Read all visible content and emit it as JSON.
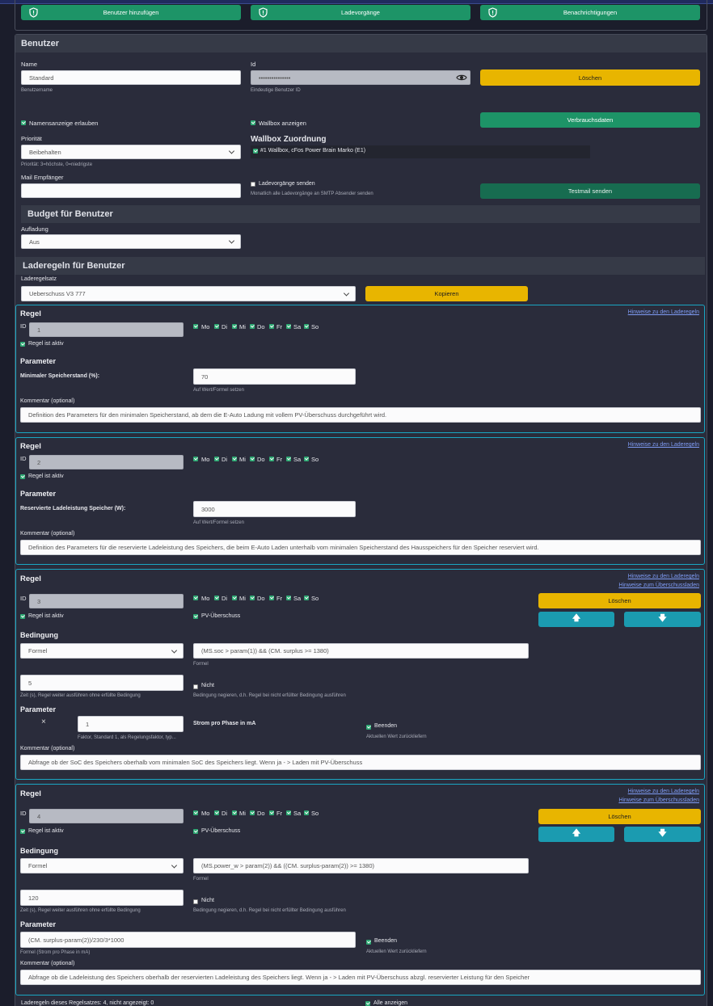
{
  "toolbar": {
    "add_user": "Benutzer hinzufügen",
    "charges": "Ladevorgänge",
    "notifications": "Benachrichtigungen"
  },
  "user": {
    "section_title": "Benutzer",
    "name_label": "Name",
    "name_value": "Standard",
    "name_hint": "Benutzername",
    "id_label": "Id",
    "id_value": "•••••••••••••••",
    "id_hint": "Eindeutige Benutzer ID",
    "delete": "Löschen",
    "show_name": "Namensanzeige erlauben",
    "show_wallbox": "Wallbox anzeigen",
    "consumption": "Verbrauchsdaten",
    "priority_label": "Priorität",
    "priority_value": "Beibehalten",
    "priority_hint": "Priorität: 3=höchste, 0=niedrigste",
    "wallbox_title": "Wallbox Zuordnung",
    "wallbox_item": "#1 Wallbox, cFos Power Brain Marko (E1)",
    "mail_label": "Mail Empfänger",
    "mail_value": "",
    "send_charges": "Ladevorgänge senden",
    "send_charges_hint": "Monatlich alle Ladevorgänge an SMTP Absender senden",
    "testmail": "Testmail senden"
  },
  "budget": {
    "title": "Budget für Benutzer",
    "charge_label": "Aufladung",
    "charge_value": "Aus"
  },
  "rules_section": {
    "title": "Laderegeln für Benutzer",
    "set_label": "Laderegelsatz",
    "set_value": "Ueberschuss V3 777",
    "copy": "Kopieren"
  },
  "common": {
    "rule": "Regel",
    "id": "ID",
    "active": "Regel ist aktiv",
    "params": "Parameter",
    "condition": "Bedingung",
    "comment": "Kommentar (optional)",
    "hint_rules": "Hinweise zu den Laderegeln",
    "hint_surplus": "Hinweise zum Überschussladen",
    "delete": "Löschen",
    "up": "🡅",
    "down": "🡇",
    "set_value_hint": "Auf Wert/Formel setzen",
    "pv": "PV-Überschuss",
    "formula_hint": "Formel",
    "not_label": "Nicht",
    "not_hint": "Bedingung negieren, d.h. Regel bei nicht erfüllter Bedingung ausführen",
    "time_hint": "Zeit (s), Regel weiter ausführen ohne erfüllte Bedingung",
    "end": "Beenden",
    "end_hint": "Aktuellen Wert zurückliefern",
    "days": [
      "Mo",
      "Di",
      "Mi",
      "Do",
      "Fr",
      "Sa",
      "So"
    ]
  },
  "rules": [
    {
      "id": "1",
      "param_label": "Minimaler Speicherstand (%):",
      "param_value": "70",
      "comment": "Definition des Parameters für den minimalen Speicherstand, ab dem die E-Auto Ladung mit vollem PV-Überschuss durchgeführt wird."
    },
    {
      "id": "2",
      "param_label": "Reservierte Ladeleistung Speicher (W):",
      "param_value": "3000",
      "comment": "Definition des Parameters für die reservierte Ladeleistung des Speichers, die beim E-Auto Laden unterhalb vom minimalen Speicherstand des Hausspeichers für den Speicher reserviert wird."
    },
    {
      "id": "3",
      "cond_type": "Formel",
      "formula": "(MS.soc > param(1)) && (CM. surplus >= 1380)",
      "time": "5",
      "mult": "×",
      "factor": "1",
      "factor_hint": "Faktor, Standard 1, als Regelungsfaktor, typ...",
      "param_name": "Strom pro Phase in mA",
      "comment": "Abfrage ob der SoC des Speichers oberhalb vom minimalen SoC des Speichers liegt. Wenn ja - > Laden mit PV-Überschuss"
    },
    {
      "id": "4",
      "cond_type": "Formel",
      "formula": "(MS.power_w > param(2)) && ((CM. surplus-param(2)) >= 1380)",
      "time": "120",
      "param_formula": "(CM. surplus-param(2))/230/3*1000",
      "param_formula_hint": "Formel (Strom pro Phase in mA)",
      "comment": "Abfrage ob die Ladeleistung des Speichers oberhalb der reservierten Ladeleistung des Speichers liegt. Wenn ja - > Laden mit PV-Überschuss abzgl. reservierter Leistung für den Speicher"
    }
  ],
  "footer": {
    "count": "Laderegeln dieses Regelsatzes: 4, nicht angezeigt: 0",
    "show_all": "Alle anzeigen"
  },
  "colors": {
    "bg": "#1b1d2b",
    "panel": "#2a2c3b",
    "green": "#1d9467",
    "yellow": "#e8b500",
    "teal": "#1b9bb0",
    "rule_border": "#1aa6c2"
  }
}
